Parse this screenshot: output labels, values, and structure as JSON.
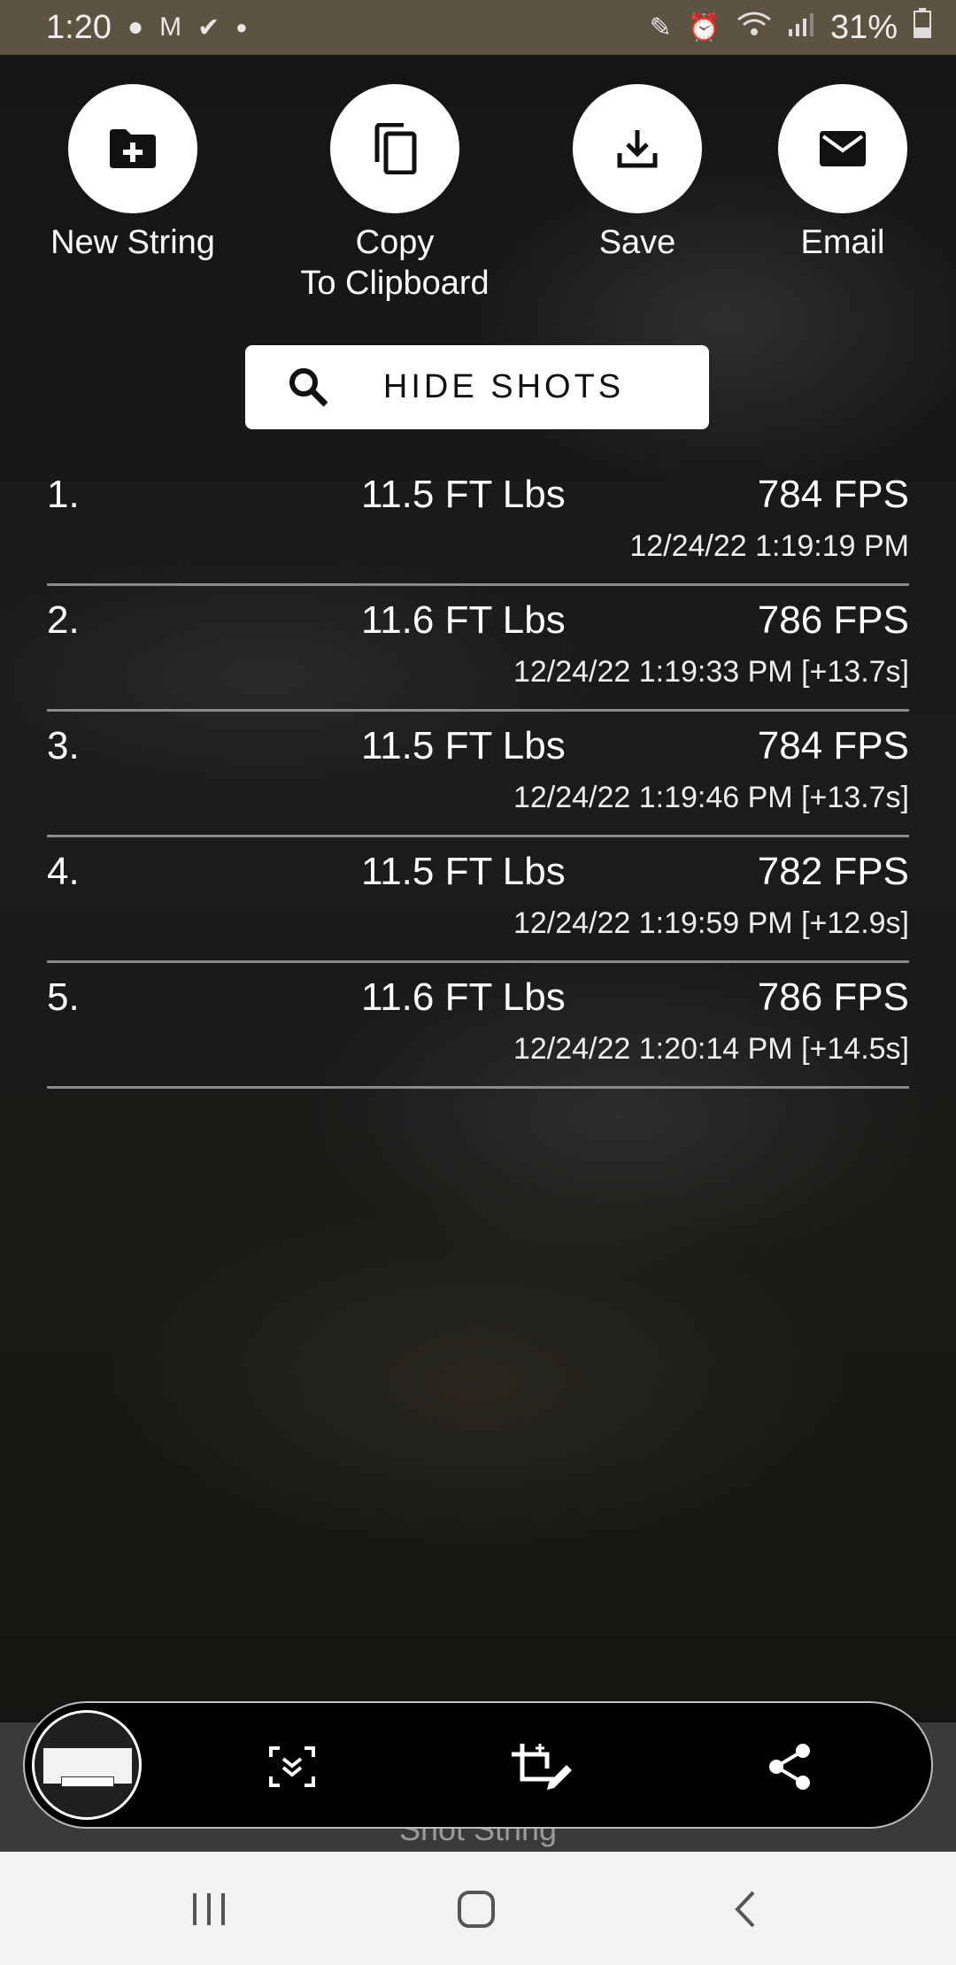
{
  "status_bar": {
    "time": "1:20",
    "battery": "31%"
  },
  "actions": [
    {
      "label": "New String",
      "icon": "folder-add-icon"
    },
    {
      "label": "Copy",
      "label2": "To Clipboard",
      "icon": "copy-icon"
    },
    {
      "label": "Save",
      "icon": "download-icon"
    },
    {
      "label": "Email",
      "icon": "email-icon"
    }
  ],
  "hide_shots": {
    "label": "HIDE SHOTS",
    "icon": "search-icon"
  },
  "shots": [
    {
      "num": "1.",
      "energy": "11.5 FT Lbs",
      "fps": "784 FPS",
      "time": "12/24/22 1:19:19 PM"
    },
    {
      "num": "2.",
      "energy": "11.6 FT Lbs",
      "fps": "786 FPS",
      "time": "12/24/22 1:19:33 PM [+13.7s]"
    },
    {
      "num": "3.",
      "energy": "11.5 FT Lbs",
      "fps": "784 FPS",
      "time": "12/24/22 1:19:46 PM [+13.7s]"
    },
    {
      "num": "4.",
      "energy": "11.5 FT Lbs",
      "fps": "782 FPS",
      "time": "12/24/22 1:19:59 PM [+12.9s]"
    },
    {
      "num": "5.",
      "energy": "11.6 FT Lbs",
      "fps": "786 FPS",
      "time": "12/24/22 1:20:14 PM [+14.5s]"
    }
  ],
  "screenshot_toolbar": {
    "icons": [
      "scroll-capture-icon",
      "crop-edit-icon",
      "share-icon"
    ]
  },
  "under_text": "Shot String",
  "nav_bar": {
    "icons": [
      "recents-icon",
      "home-icon",
      "back-icon"
    ]
  }
}
